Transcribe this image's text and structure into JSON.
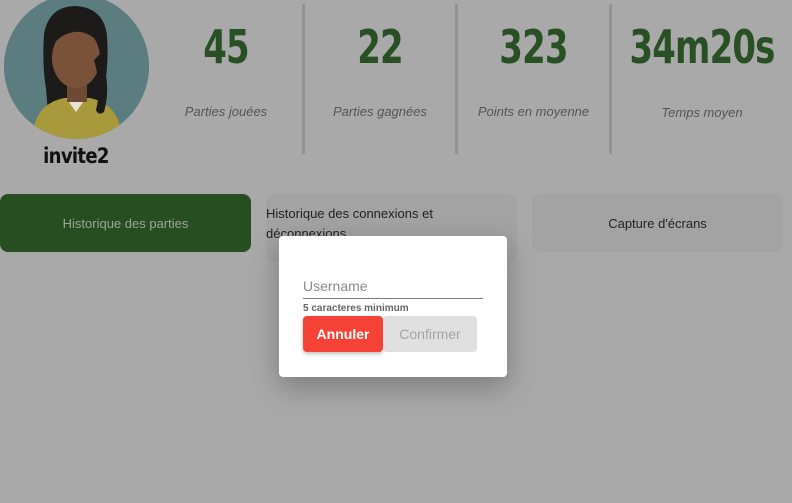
{
  "profile": {
    "username": "invite2",
    "avatar_icon": "avatar-woman-icon"
  },
  "stats": [
    {
      "value": "45",
      "label": "Parties jouées"
    },
    {
      "value": "22",
      "label": "Parties gagnées"
    },
    {
      "value": "323",
      "label": "Points en moyenne"
    },
    {
      "value": "34m20s",
      "label": "Temps moyen"
    }
  ],
  "tabs": [
    {
      "label": "Historique des parties",
      "active": true
    },
    {
      "label": "Historique des connexions et déconnexions",
      "active": false
    },
    {
      "label": "Capture d'écrans",
      "active": false
    }
  ],
  "dialog": {
    "username_placeholder": "Username",
    "username_value": "",
    "hint": "5 caracteres minimum",
    "cancel_label": "Annuler",
    "confirm_label": "Confirmer"
  },
  "colors": {
    "accent": "#274e21",
    "stat_value": "#285024",
    "cancel": "#f44336",
    "overlay": "#a9a9a9"
  }
}
